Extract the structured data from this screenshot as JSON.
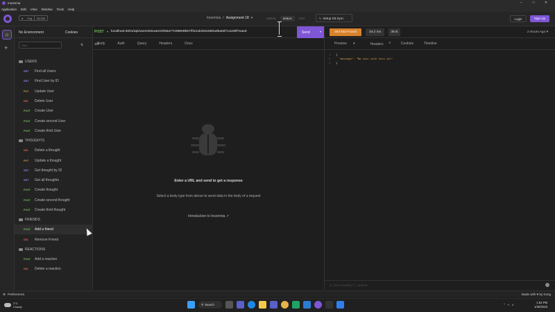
{
  "window": {
    "title": "Insomnia"
  },
  "menu": [
    "Application",
    "Edit",
    "View",
    "Window",
    "Tools",
    "Help"
  ],
  "header": {
    "gh_org": "Org",
    "gh_stars": "26,940",
    "project": "Insomnia",
    "separator": "/",
    "document": "Assignment 18",
    "modes": [
      "DESIGN",
      "DEBUG",
      "TEST"
    ],
    "active_mode": "DEBUG",
    "git_sync": "Setup Git Sync",
    "login": "Login",
    "signup": "Sign Up"
  },
  "sidebar": {
    "environment": "No Environment",
    "cookies": "Cookies",
    "filter_placeholder": "Filter",
    "folders": [
      {
        "name": "USERS",
        "requests": [
          {
            "method": "GET",
            "name": "Find all Users"
          },
          {
            "method": "GET",
            "name": "Find User by ID"
          },
          {
            "method": "PUT",
            "name": "Update User"
          },
          {
            "method": "DEL",
            "name": "Delete User"
          },
          {
            "method": "POST",
            "name": "Create User"
          },
          {
            "method": "POST",
            "name": "Create second User"
          },
          {
            "method": "POST",
            "name": "Create third User"
          }
        ]
      },
      {
        "name": "THOUGHTS",
        "requests": [
          {
            "method": "DEL",
            "name": "Delete a thought"
          },
          {
            "method": "PUT",
            "name": "Update a thought"
          },
          {
            "method": "GET",
            "name": "Get thought by ID"
          },
          {
            "method": "GET",
            "name": "Get all thoughts"
          },
          {
            "method": "POST",
            "name": "Create thought"
          },
          {
            "method": "POST",
            "name": "Create second thought"
          },
          {
            "method": "POST",
            "name": "Create third thought"
          }
        ]
      },
      {
        "name": "FRIENDS",
        "requests": [
          {
            "method": "POST",
            "name": "Add a friend",
            "selected": true
          },
          {
            "method": "DEL",
            "name": "Remove Friend"
          }
        ]
      },
      {
        "name": "REACTIONS",
        "requests": [
          {
            "method": "POST",
            "name": "Add a reaction"
          },
          {
            "method": "DEL",
            "name": "Delete a reaction"
          }
        ]
      }
    ],
    "preferences": "Preferences"
  },
  "request": {
    "method": "POST",
    "url": "localhost:3001/api/users/63cae243f45a77c99509b57/friends/63c580a3ba0d714c89f7eaed",
    "send": "Send",
    "tabs": [
      "Body",
      "Auth",
      "Query",
      "Headers",
      "Docs"
    ],
    "empty_title": "Enter a URL and send to get a response",
    "empty_sub": "Select a body type from above to send data in the body of a request",
    "intro_link": "Introduction to Insomnia"
  },
  "response": {
    "status": "404 Not Found",
    "time": "34.2 ms",
    "size": "35 B",
    "ago": "2 Hours Ago",
    "tabs": [
      "Preview",
      "Headers",
      "Cookies",
      "Timeline"
    ],
    "headers_count": "8",
    "body_lines": [
      "{",
      "  \"message\": \"No user with this id!\"",
      "}"
    ],
    "filter_placeholder": "$.store.books[*].author"
  },
  "footer": {
    "made_with": "Made with ♥ by Kong"
  },
  "taskbar": {
    "weather_temp": "2°C",
    "weather_desc": "Cloudy",
    "search": "Search",
    "time": "1:52 PM",
    "date": "1/30/2023"
  },
  "colors": {
    "accent": "#7e56d6",
    "status_warn": "#d8822c",
    "get": "#9c86e8",
    "post": "#6fbf57",
    "put": "#d29a50",
    "del": "#d9624e"
  }
}
